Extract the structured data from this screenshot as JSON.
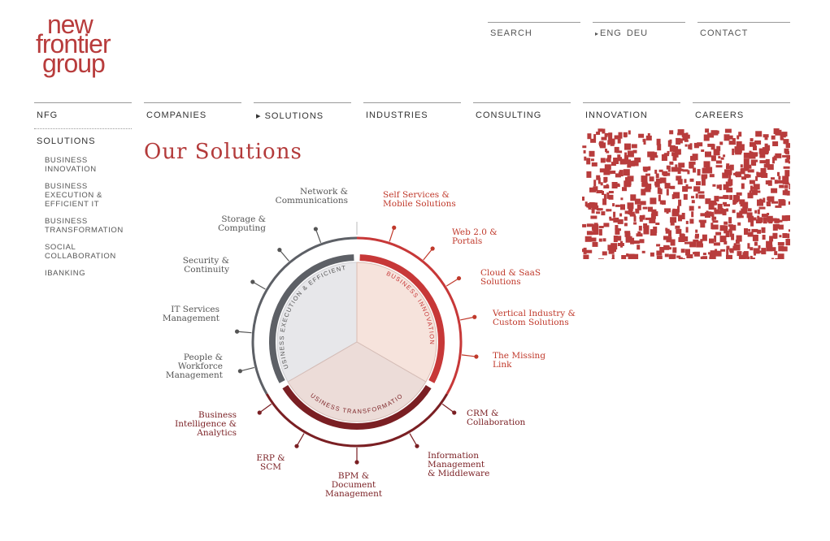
{
  "logo": {
    "line1": "new",
    "line2": "frontier",
    "line3": "group"
  },
  "topnav": {
    "search": "SEARCH",
    "lang_arrow": "▸",
    "lang_eng": "ENG",
    "lang_deu": "DEU",
    "contact": "CONTACT"
  },
  "mainnav": [
    "NFG",
    "COMPANIES",
    "▸ SOLUTIONS",
    "INDUSTRIES",
    "CONSULTING",
    "INNOVATION",
    "CAREERS"
  ],
  "sidenav": {
    "heading": "SOLUTIONS",
    "items": [
      {
        "label": "BUSINESS INNOVATION"
      },
      {
        "label": "BUSINESS EXECUTION & EFFICIENT IT"
      },
      {
        "label": "BUSINESS TRANSFORMATION"
      },
      {
        "label": "SOCIAL COLLABORATION"
      },
      {
        "label": "IBANKING"
      }
    ]
  },
  "page_title": "Our Solutions",
  "colors": {
    "brand": "#b83c3c",
    "grey": "#5d6066",
    "dark_red": "#7a1f23",
    "light_red": "#c73838"
  },
  "diagram": {
    "segments": [
      {
        "name": "BUSINESS EXECUTION & EFFICIENT IT"
      },
      {
        "name": "BUSINESS INNOVATION"
      },
      {
        "name": "BUSINESS TRANSFORMATION"
      }
    ],
    "labels": [
      {
        "lines": [
          "Network &",
          "Communications"
        ],
        "group": "grey"
      },
      {
        "lines": [
          "Storage &",
          "Computing"
        ],
        "group": "grey"
      },
      {
        "lines": [
          "Security &",
          "Continuity"
        ],
        "group": "grey"
      },
      {
        "lines": [
          "IT Services",
          "Management"
        ],
        "group": "grey"
      },
      {
        "lines": [
          "People &",
          "Workforce",
          "Management"
        ],
        "group": "grey"
      },
      {
        "lines": [
          "Self Services &",
          "Mobile Solutions"
        ],
        "group": "red"
      },
      {
        "lines": [
          "Web 2.0 &",
          "Portals"
        ],
        "group": "red"
      },
      {
        "lines": [
          "Cloud & SaaS",
          "Solutions"
        ],
        "group": "red"
      },
      {
        "lines": [
          "Vertical Industry &",
          "Custom Solutions"
        ],
        "group": "red"
      },
      {
        "lines": [
          "The Missing",
          "Link"
        ],
        "group": "red"
      },
      {
        "lines": [
          "CRM &",
          "Collaboration"
        ],
        "group": "dark"
      },
      {
        "lines": [
          "Information",
          "Management",
          "& Middleware"
        ],
        "group": "dark"
      },
      {
        "lines": [
          "BPM &",
          "Document",
          "Management"
        ],
        "group": "dark"
      },
      {
        "lines": [
          "ERP &",
          "SCM"
        ],
        "group": "dark"
      },
      {
        "lines": [
          "Business",
          "Intelligence &",
          "Analytics"
        ],
        "group": "dark"
      }
    ]
  }
}
